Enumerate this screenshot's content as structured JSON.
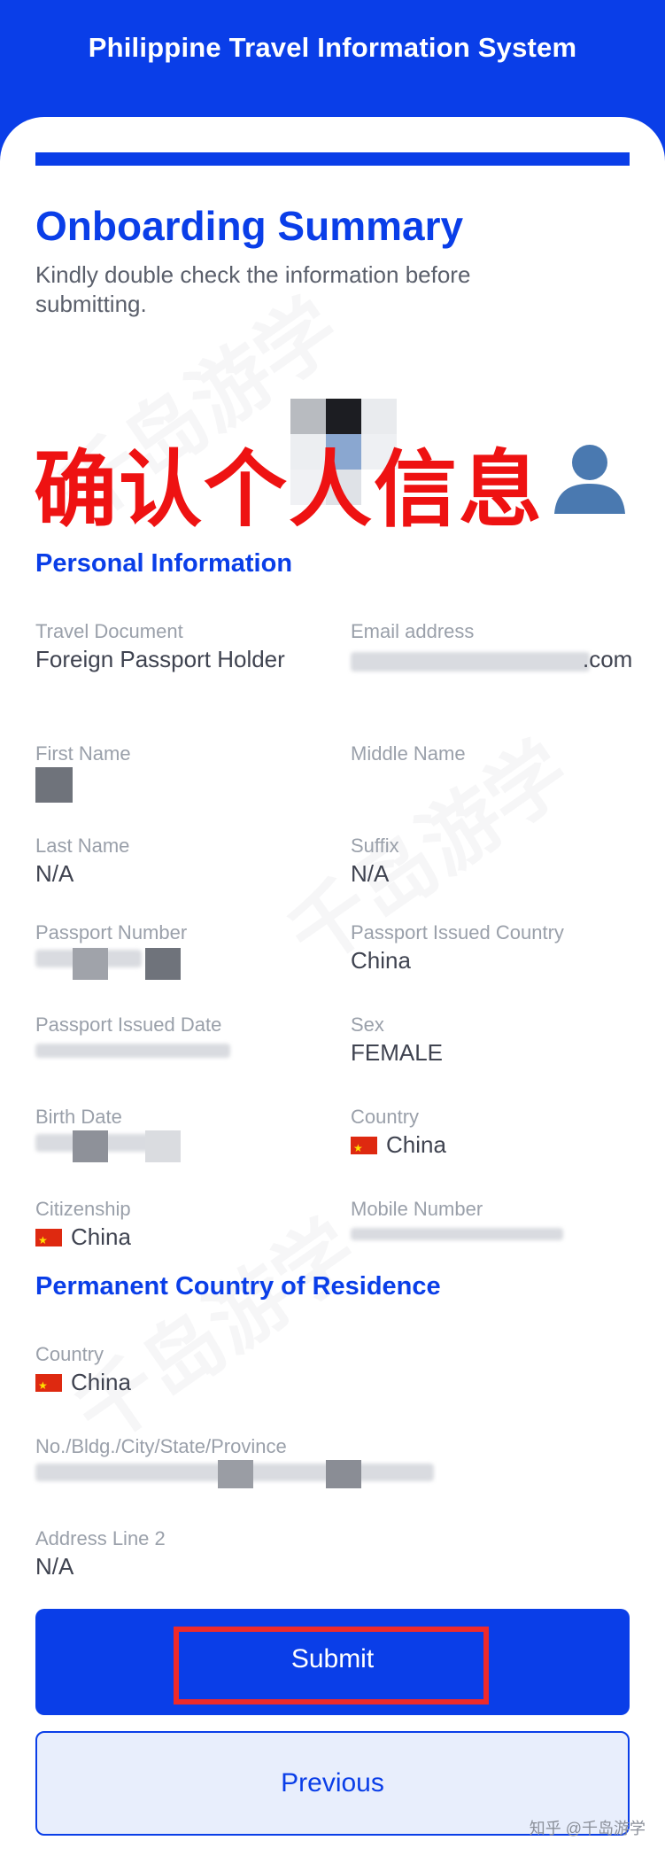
{
  "header": {
    "title": "Philippine Travel Information System"
  },
  "summary": {
    "title": "Onboarding Summary",
    "subtitle": "Kindly double check the information before submitting."
  },
  "overlay": {
    "caption": "确认个人信息"
  },
  "personal": {
    "section_title": "Personal Information",
    "travel_document_label": "Travel Document",
    "travel_document_value": "Foreign Passport Holder",
    "email_label": "Email address",
    "email_value_suffix": ".com",
    "first_name_label": "First Name",
    "middle_name_label": "Middle Name",
    "last_name_label": "Last Name",
    "last_name_value": "N/A",
    "suffix_label": "Suffix",
    "suffix_value": "N/A",
    "passport_number_label": "Passport Number",
    "passport_country_label": "Passport Issued Country",
    "passport_country_value": "China",
    "passport_date_label": "Passport Issued Date",
    "sex_label": "Sex",
    "sex_value": "FEMALE",
    "birth_date_label": "Birth Date",
    "country_label": "Country",
    "country_value": "China",
    "citizenship_label": "Citizenship",
    "citizenship_value": "China",
    "mobile_label": "Mobile Number"
  },
  "residence": {
    "section_title": "Permanent Country of Residence",
    "country_label": "Country",
    "country_value": "China",
    "address_label": "No./Bldg./City/State/Province",
    "address2_label": "Address Line 2",
    "address2_value": "N/A"
  },
  "actions": {
    "submit_label": "Submit",
    "previous_label": "Previous"
  },
  "watermark": {
    "text": "知乎 @千岛游学"
  },
  "colors": {
    "brand": "#0a3ee8",
    "highlight": "#ee2a2a",
    "flag": "#de2910"
  }
}
